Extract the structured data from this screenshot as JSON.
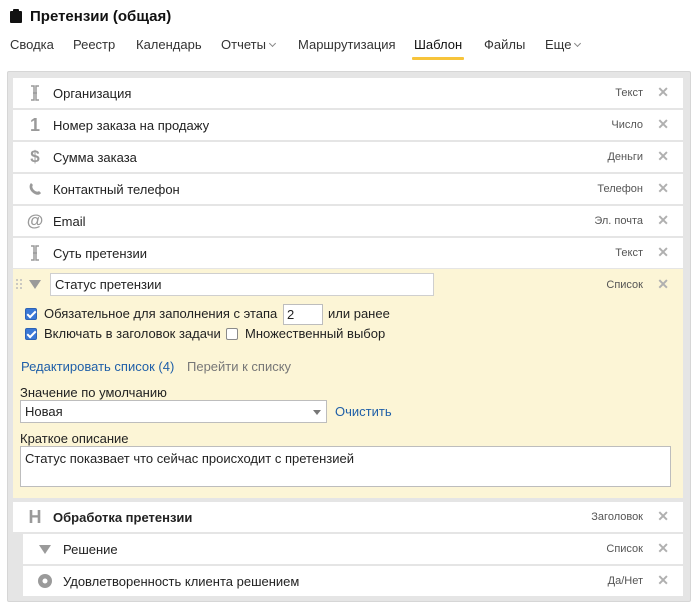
{
  "app": {
    "title": "Претензии (общая)"
  },
  "tabs": [
    {
      "label": "Сводка",
      "active": false,
      "dropdown": false
    },
    {
      "label": "Реестр",
      "active": false,
      "dropdown": false
    },
    {
      "label": "Календарь",
      "active": false,
      "dropdown": false
    },
    {
      "label": "Отчеты",
      "active": false,
      "dropdown": true
    },
    {
      "label": "Маршрутизация",
      "active": false,
      "dropdown": false
    },
    {
      "label": "Шаблон",
      "active": true,
      "dropdown": false
    },
    {
      "label": "Файлы",
      "active": false,
      "dropdown": false
    },
    {
      "label": "Еще",
      "active": false,
      "dropdown": true
    }
  ],
  "fields_top": [
    {
      "label": "Организация",
      "type": "Текст",
      "icon": "text-cursor-icon"
    },
    {
      "label": "Номер заказа на продажу",
      "type": "Число",
      "icon": "number-icon"
    },
    {
      "label": "Сумма заказа",
      "type": "Деньги",
      "icon": "dollar-icon"
    },
    {
      "label": "Контактный телефон",
      "type": "Телефон",
      "icon": "phone-icon"
    },
    {
      "label": "Email",
      "type": "Эл. почта",
      "icon": "at-icon"
    },
    {
      "label": "Суть претензии",
      "type": "Текст",
      "icon": "text-cursor-icon"
    }
  ],
  "expanded_field": {
    "name_value": "Статус претензии",
    "type": "Список",
    "required_label": "Обязательное для заполнения с этапа",
    "required_checked": true,
    "stage_value": "2",
    "or_earlier": "или ранее",
    "include_in_title_label": "Включать в заголовок задачи",
    "include_in_title_checked": true,
    "multiple_choice_label": "Множественный выбор",
    "multiple_choice_checked": false,
    "edit_list_link": "Редактировать список (4)",
    "go_to_list_link": "Перейти к списку",
    "default_value_label": "Значение по умолчанию",
    "default_value": "Новая",
    "clear_link": "Очистить",
    "short_description_label": "Краткое описание",
    "short_description": "Статус показвает что сейчас происходит с претензией"
  },
  "header_field": {
    "label": "Обработка претензии",
    "type": "Заголовок",
    "icon": "heading-icon"
  },
  "sub_fields": [
    {
      "label": "Решение",
      "type": "Список",
      "icon": "triangle-down-icon"
    },
    {
      "label": "Удовлетворенность клиента решением",
      "type": "Да/Нет",
      "icon": "radio-dot-icon"
    }
  ],
  "colors": {
    "accent_tab": "#f7c43b",
    "expanded_bg": "#fcf5d6",
    "link": "#1f5fa8",
    "checkbox": "#3a78d6"
  }
}
